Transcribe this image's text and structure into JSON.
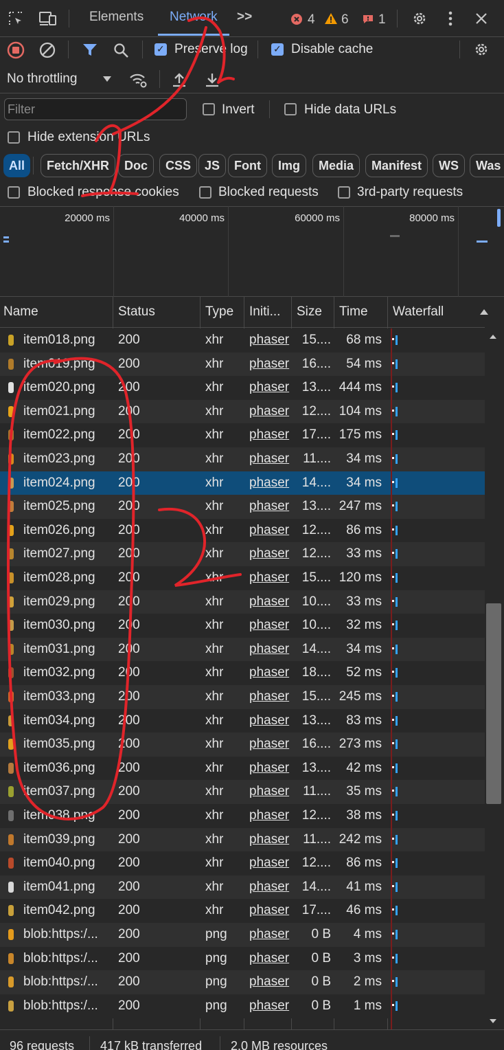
{
  "tabs": {
    "elements": "Elements",
    "network": "Network",
    "more": ">>",
    "errors": "4",
    "warnings": "6",
    "issues": "1"
  },
  "toolbar": {
    "preserve_log": "Preserve log",
    "disable_cache": "Disable cache",
    "throttling": "No throttling"
  },
  "filter": {
    "placeholder": "Filter",
    "invert": "Invert",
    "hide_data_urls": "Hide data URLs",
    "hide_extension_urls": "Hide extension URLs"
  },
  "chips": [
    "All",
    "Fetch/XHR",
    "Doc",
    "CSS",
    "JS",
    "Font",
    "Img",
    "Media",
    "Manifest",
    "WS",
    "Was"
  ],
  "blocked": {
    "cookies": "Blocked response cookies",
    "requests": "Blocked requests",
    "third_party": "3rd-party requests"
  },
  "overview": {
    "ticks": [
      "20000 ms",
      "40000 ms",
      "60000 ms",
      "80000 ms"
    ]
  },
  "columns": {
    "name": "Name",
    "status": "Status",
    "type": "Type",
    "initiator": "Initi...",
    "size": "Size",
    "time": "Time",
    "waterfall": "Waterfall"
  },
  "rows": [
    {
      "name": "item018.png",
      "status": "200",
      "type": "xhr",
      "init": "phaser",
      "size": "15....",
      "time": "68 ms",
      "color": "#c9a227"
    },
    {
      "name": "item019.png",
      "status": "200",
      "type": "xhr",
      "init": "phaser",
      "size": "16....",
      "time": "54 ms",
      "color": "#b07b2a"
    },
    {
      "name": "item020.png",
      "status": "200",
      "type": "xhr",
      "init": "phaser",
      "size": "13....",
      "time": "444 ms",
      "color": "#e0e0e0"
    },
    {
      "name": "item021.png",
      "status": "200",
      "type": "xhr",
      "init": "phaser",
      "size": "12....",
      "time": "104 ms",
      "color": "#e7a318"
    },
    {
      "name": "item022.png",
      "status": "200",
      "type": "xhr",
      "init": "phaser",
      "size": "17....",
      "time": "175 ms",
      "color": "#a8722c"
    },
    {
      "name": "item023.png",
      "status": "200",
      "type": "xhr",
      "init": "phaser",
      "size": "11....",
      "time": "34 ms",
      "color": "#d98a1c"
    },
    {
      "name": "item024.png",
      "status": "200",
      "type": "xhr",
      "init": "phaser",
      "size": "14....",
      "time": "34 ms",
      "color": "#c79a52"
    },
    {
      "name": "item025.png",
      "status": "200",
      "type": "xhr",
      "init": "phaser",
      "size": "13....",
      "time": "247 ms",
      "color": "#c27b3a"
    },
    {
      "name": "item026.png",
      "status": "200",
      "type": "xhr",
      "init": "phaser",
      "size": "12....",
      "time": "86 ms",
      "color": "#e3a21a"
    },
    {
      "name": "item027.png",
      "status": "200",
      "type": "xhr",
      "init": "phaser",
      "size": "12....",
      "time": "33 ms",
      "color": "#b8862e"
    },
    {
      "name": "item028.png",
      "status": "200",
      "type": "xhr",
      "init": "phaser",
      "size": "15....",
      "time": "120 ms",
      "color": "#c8902a"
    },
    {
      "name": "item029.png",
      "status": "200",
      "type": "xhr",
      "init": "phaser",
      "size": "10....",
      "time": "33 ms",
      "color": "#d0a23a"
    },
    {
      "name": "item030.png",
      "status": "200",
      "type": "xhr",
      "init": "phaser",
      "size": "10....",
      "time": "32 ms",
      "color": "#c59a48"
    },
    {
      "name": "item031.png",
      "status": "200",
      "type": "xhr",
      "init": "phaser",
      "size": "14....",
      "time": "34 ms",
      "color": "#b9862a"
    },
    {
      "name": "item032.png",
      "status": "200",
      "type": "xhr",
      "init": "phaser",
      "size": "18....",
      "time": "52 ms",
      "color": "#a0522d"
    },
    {
      "name": "item033.png",
      "status": "200",
      "type": "xhr",
      "init": "phaser",
      "size": "15....",
      "time": "245 ms",
      "color": "#d2642a"
    },
    {
      "name": "item034.png",
      "status": "200",
      "type": "xhr",
      "init": "phaser",
      "size": "13....",
      "time": "83 ms",
      "color": "#c89a38"
    },
    {
      "name": "item035.png",
      "status": "200",
      "type": "xhr",
      "init": "phaser",
      "size": "16....",
      "time": "273 ms",
      "color": "#e0a01e"
    },
    {
      "name": "item036.png",
      "status": "200",
      "type": "xhr",
      "init": "phaser",
      "size": "13....",
      "time": "42 ms",
      "color": "#b47a3c"
    },
    {
      "name": "item037.png",
      "status": "200",
      "type": "xhr",
      "init": "phaser",
      "size": "11....",
      "time": "35 ms",
      "color": "#9aa030"
    },
    {
      "name": "item038.png",
      "status": "200",
      "type": "xhr",
      "init": "phaser",
      "size": "12....",
      "time": "38 ms",
      "color": "#6e6e6e"
    },
    {
      "name": "item039.png",
      "status": "200",
      "type": "xhr",
      "init": "phaser",
      "size": "11....",
      "time": "242 ms",
      "color": "#c0782c"
    },
    {
      "name": "item040.png",
      "status": "200",
      "type": "xhr",
      "init": "phaser",
      "size": "12....",
      "time": "86 ms",
      "color": "#b84a2a"
    },
    {
      "name": "item041.png",
      "status": "200",
      "type": "xhr",
      "init": "phaser",
      "size": "14....",
      "time": "41 ms",
      "color": "#d8d8d8"
    },
    {
      "name": "item042.png",
      "status": "200",
      "type": "xhr",
      "init": "phaser",
      "size": "17....",
      "time": "46 ms",
      "color": "#c8a03a"
    },
    {
      "name": "blob:https:/...",
      "status": "200",
      "type": "png",
      "init": "phaser",
      "size": "0 B",
      "time": "4 ms",
      "color": "#e39a1c"
    },
    {
      "name": "blob:https:/...",
      "status": "200",
      "type": "png",
      "init": "phaser",
      "size": "0 B",
      "time": "3 ms",
      "color": "#c8862a"
    },
    {
      "name": "blob:https:/...",
      "status": "200",
      "type": "png",
      "init": "phaser",
      "size": "0 B",
      "time": "2 ms",
      "color": "#d89a2a"
    },
    {
      "name": "blob:https:/...",
      "status": "200",
      "type": "png",
      "init": "phaser",
      "size": "0 B",
      "time": "1 ms",
      "color": "#c8a040"
    }
  ],
  "statusbar": {
    "requests": "96 requests",
    "transferred": "417 kB transferred",
    "resources": "2.0 MB resources"
  },
  "annotations": {
    "mark_1": "1",
    "mark_2": "2"
  }
}
